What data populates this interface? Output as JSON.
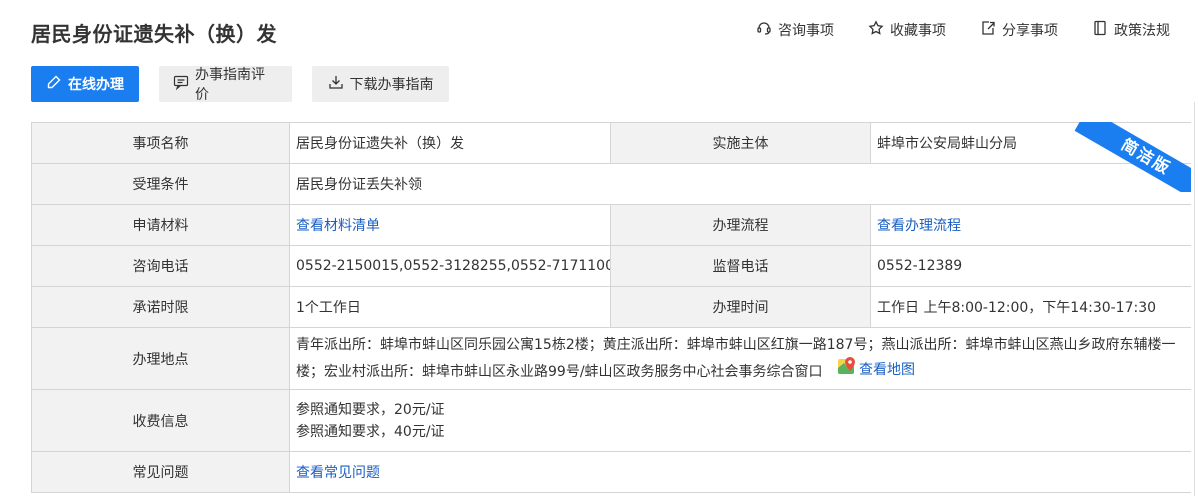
{
  "title": "居民身份证遗失补（换）发",
  "top_actions": [
    {
      "label": "咨询事项",
      "icon": "consult-icon"
    },
    {
      "label": "收藏事项",
      "icon": "star-icon"
    },
    {
      "label": "分享事项",
      "icon": "share-icon"
    },
    {
      "label": "政策法规",
      "icon": "policy-icon"
    }
  ],
  "buttons": {
    "online": "在线办理",
    "evaluate": "办事指南评价",
    "download": "下载办事指南"
  },
  "ribbon": "简洁版",
  "rows": {
    "name_label": "事项名称",
    "name_value": "居民身份证遗失补（换）发",
    "subject_label": "实施主体",
    "subject_value": "蚌埠市公安局蚌山分局",
    "condition_label": "受理条件",
    "condition_value": "居民身份证丢失补领",
    "material_label": "申请材料",
    "material_link": "查看材料清单",
    "process_label": "办理流程",
    "process_link": "查看办理流程",
    "phone_label": "咨询电话",
    "phone_value": "0552-2150015,0552-3128255,0552-7171100...",
    "supervise_label": "监督电话",
    "supervise_value": "0552-12389",
    "limit_label": "承诺时限",
    "limit_value": "1个工作日",
    "hours_label": "办理时间",
    "hours_value": "工作日 上午8:00-12:00，下午14:30-17:30",
    "location_label": "办理地点",
    "location_value": "青年派出所：蚌埠市蚌山区同乐园公寓15栋2楼；黄庄派出所：蚌埠市蚌山区红旗一路187号；燕山派出所：蚌埠市蚌山区燕山乡政府东辅楼一楼；宏业村派出所：蚌埠市蚌山区永业路99号/蚌山区政务服务中心社会事务综合窗口",
    "map_link": "查看地图",
    "fee_label": "收费信息",
    "fee_values": [
      "参照通知要求，20元/证",
      "参照通知要求，40元/证"
    ],
    "faq_label": "常见问题",
    "faq_link": "查看常见问题"
  }
}
